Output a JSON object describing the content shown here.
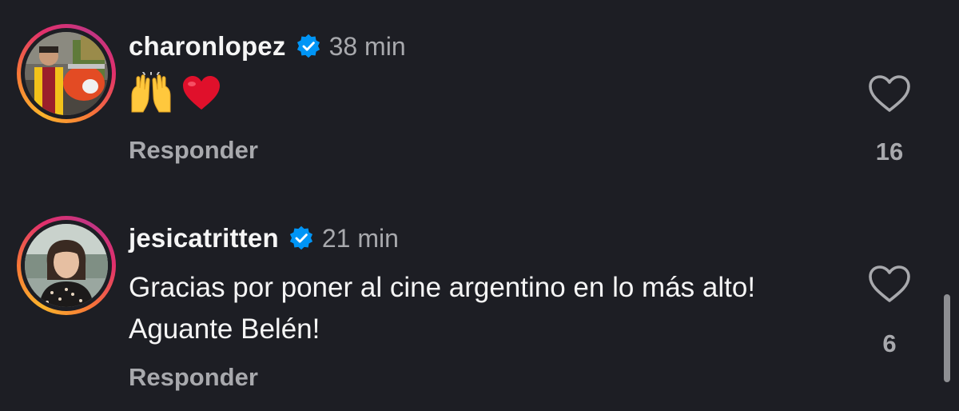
{
  "comments": [
    {
      "username": "charonlopez",
      "verified": true,
      "time": "38 min",
      "emojis": [
        "raising-hands-emoji",
        "red-heart-emoji"
      ],
      "text": "",
      "reply_label": "Responder",
      "like_icon": "heart-outline-icon",
      "like_count": "16"
    },
    {
      "username": "jesicatritten",
      "verified": true,
      "time": "21 min",
      "text": "Gracias por poner al cine argentino en lo más alto! Aguante Belén!",
      "reply_label": "Responder",
      "like_icon": "heart-outline-icon",
      "like_count": "6"
    }
  ],
  "colors": {
    "background": "#1d1e24",
    "primary_text": "#f5f5f5",
    "secondary_text": "#a8a9ad",
    "verified_blue": "#0095f6",
    "heart_red": "#e0102b"
  }
}
